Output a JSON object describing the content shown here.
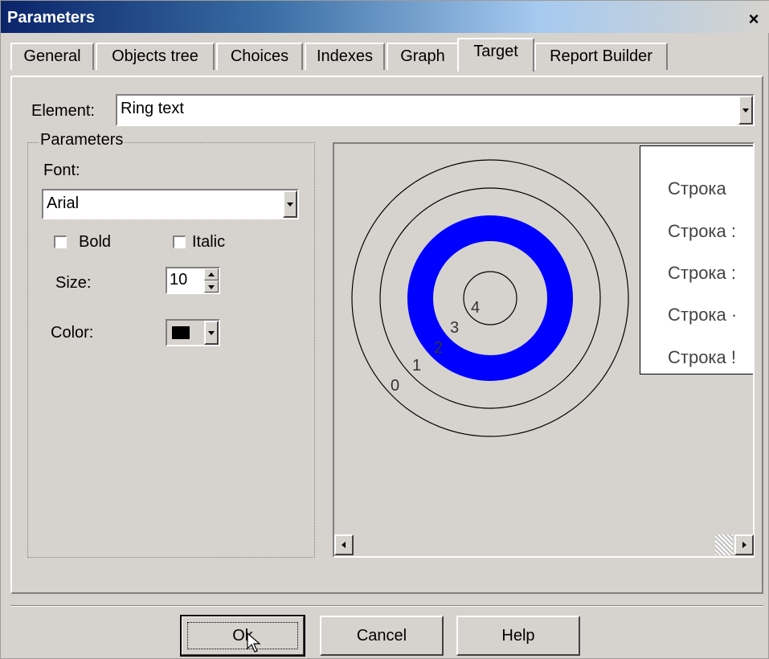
{
  "window": {
    "title": "Parameters",
    "close_icon": "×"
  },
  "tabs": [
    {
      "label": "General",
      "active": false
    },
    {
      "label": "Objects tree",
      "active": false
    },
    {
      "label": "Choices",
      "active": false
    },
    {
      "label": "Indexes",
      "active": false
    },
    {
      "label": "Graph",
      "active": false
    },
    {
      "label": "Target",
      "active": true
    },
    {
      "label": "Report Builder",
      "active": false
    }
  ],
  "element": {
    "label": "Element:",
    "value": "Ring text"
  },
  "params": {
    "group_title": "Parameters",
    "font_label": "Font:",
    "font_value": "Arial",
    "bold_label": "Bold",
    "bold_checked": false,
    "italic_label": "Italic",
    "italic_checked": false,
    "size_label": "Size:",
    "size_value": "10",
    "color_label": "Color:",
    "color_value": "#000000"
  },
  "preview": {
    "ring_labels": [
      "0",
      "1",
      "2",
      "3",
      "4"
    ],
    "highlight_color": "#0000ff",
    "legend": [
      "Строка",
      "Строка :",
      "Строка :",
      "Строка ·",
      "Строка !"
    ]
  },
  "buttons": {
    "ok": "Ok",
    "cancel": "Cancel",
    "help": "Help"
  }
}
